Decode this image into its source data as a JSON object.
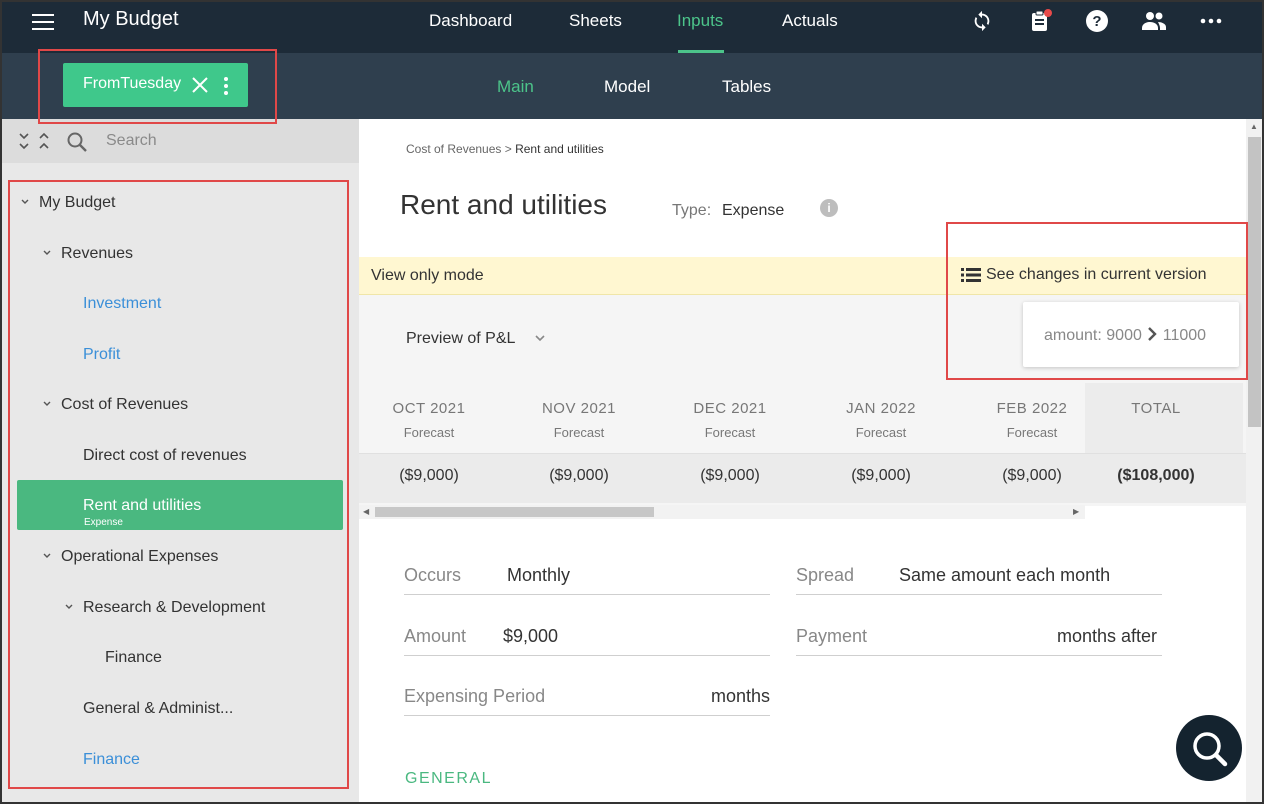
{
  "topbar": {
    "app_title": "My Budget",
    "nav": [
      "Dashboard",
      "Sheets",
      "Inputs",
      "Actuals"
    ],
    "active_nav": "Inputs",
    "accent_color": "#4cc48a",
    "icons": [
      "sync-icon",
      "clipboard-icon",
      "help-icon",
      "people-icon",
      "more-icon"
    ]
  },
  "subbar": {
    "version_name": "FromTuesday",
    "tabs": [
      "Main",
      "Model",
      "Tables"
    ],
    "active_tab": "Main"
  },
  "sidebar": {
    "search_placeholder": "Search",
    "items": [
      {
        "label": "My Budget"
      },
      {
        "label": "Revenues"
      },
      {
        "label": "Investment"
      },
      {
        "label": "Profit"
      },
      {
        "label": "Cost of Revenues"
      },
      {
        "label": "Direct cost of revenues"
      },
      {
        "label": "Rent and utilities",
        "sub": "Expense"
      },
      {
        "label": "Operational Expenses"
      },
      {
        "label": "Research & Development"
      },
      {
        "label": "Finance"
      },
      {
        "label": "General & Administ..."
      },
      {
        "label": "Finance"
      }
    ]
  },
  "main": {
    "breadcrumb_parent": "Cost of Revenues",
    "breadcrumb_sep": ">",
    "breadcrumb_current": "Rent and utilities",
    "title": "Rent and utilities",
    "type_label": "Type:",
    "type_value": "Expense",
    "view_only": "View only mode",
    "see_changes": "See changes in current version",
    "change_field": "amount:",
    "change_from": "9000",
    "change_to": "11000",
    "preview_label": "Preview of P&L",
    "columns": [
      {
        "month": "OCT 2021",
        "sub": "Forecast",
        "value": "($9,000)"
      },
      {
        "month": "NOV 2021",
        "sub": "Forecast",
        "value": "($9,000)"
      },
      {
        "month": "DEC 2021",
        "sub": "Forecast",
        "value": "($9,000)"
      },
      {
        "month": "JAN 2022",
        "sub": "Forecast",
        "value": "($9,000)"
      },
      {
        "month": "FEB 2022",
        "sub": "Forecast",
        "value": "($9,000)"
      }
    ],
    "total_label": "TOTAL",
    "total_value": "($108,000)",
    "fields": {
      "occurs_label": "Occurs",
      "occurs_value": "Monthly",
      "spread_label": "Spread",
      "spread_value": "Same amount each month",
      "amount_label": "Amount",
      "amount_value": "$9,000",
      "payment_label": "Payment",
      "payment_value": "months after",
      "expensing_label": "Expensing Period",
      "expensing_value": "months"
    },
    "section_general": "GENERAL"
  }
}
